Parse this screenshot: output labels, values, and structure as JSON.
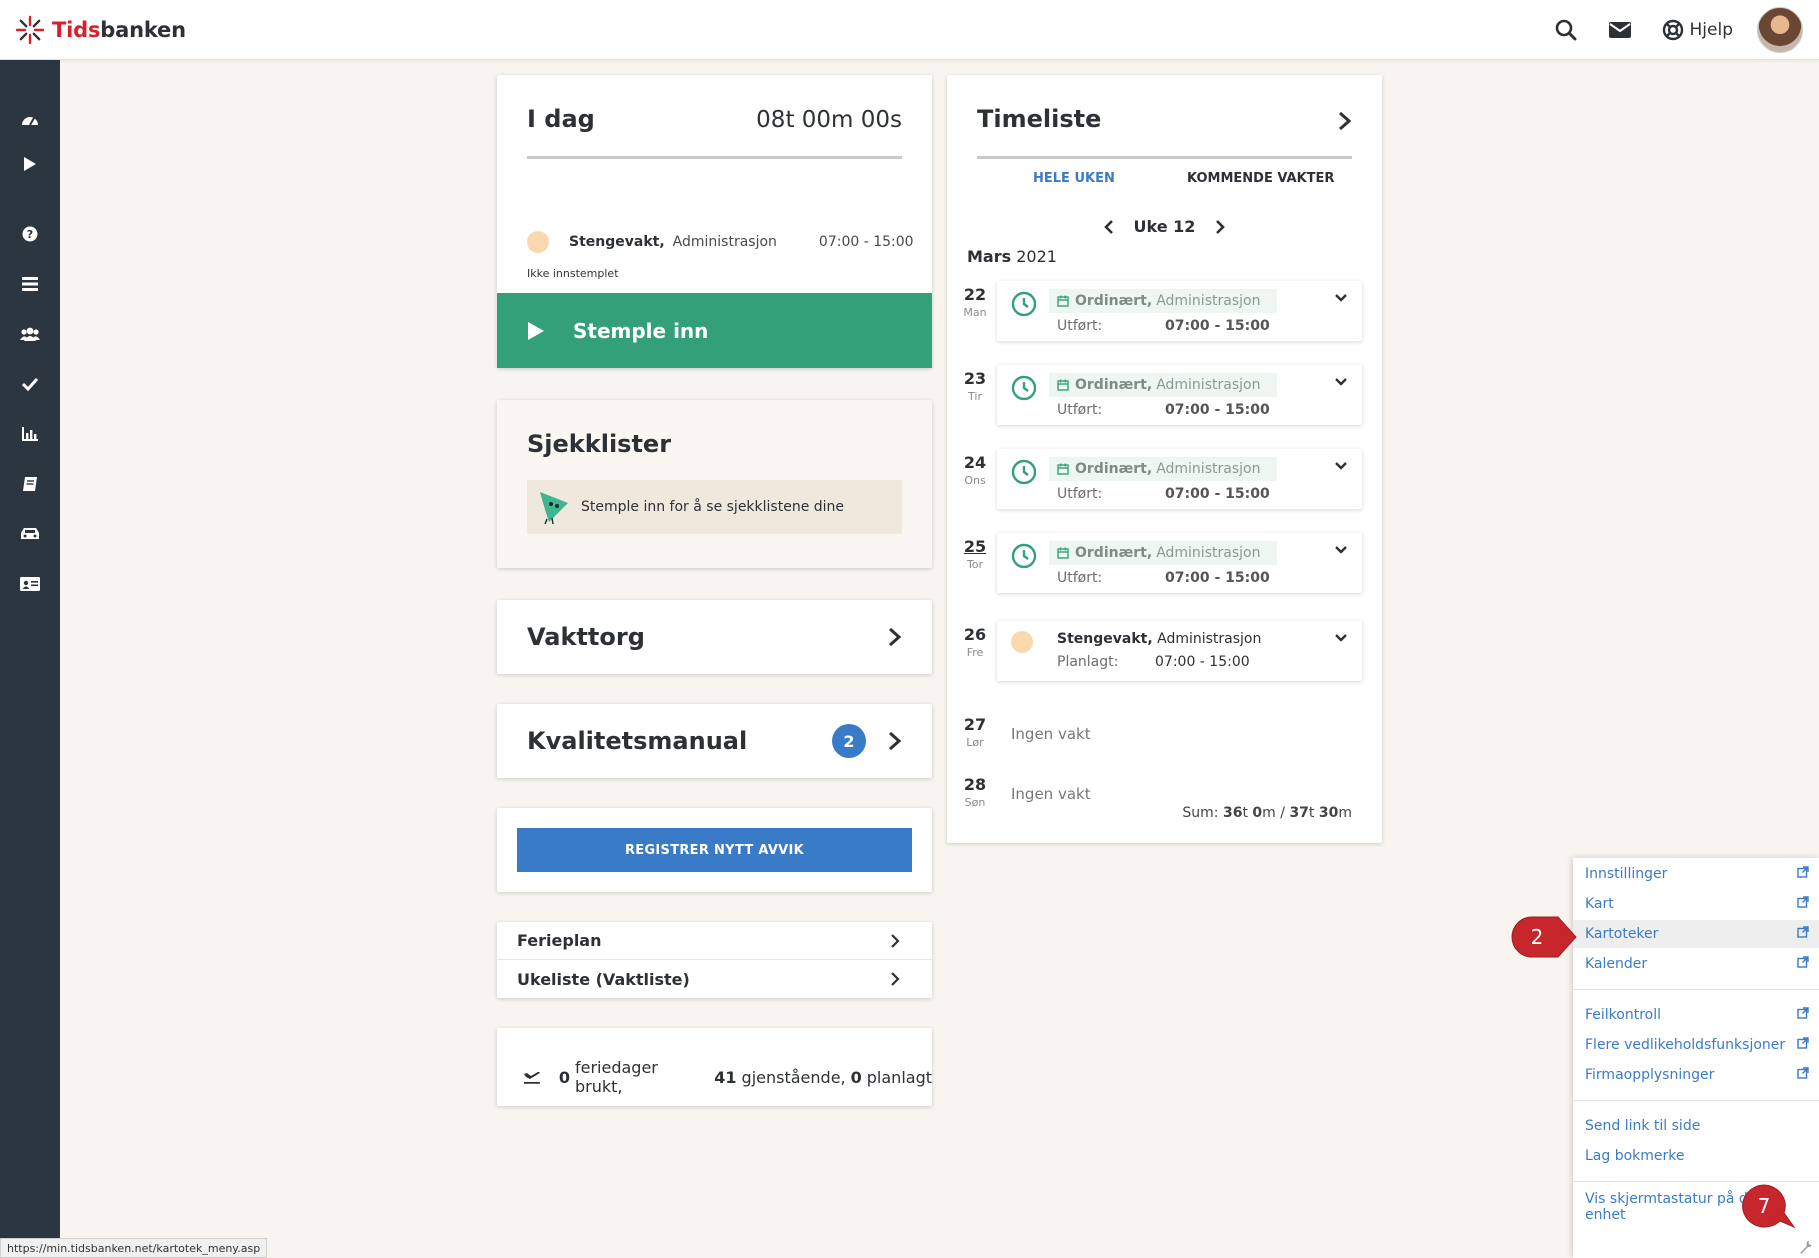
{
  "app": {
    "logo_prefix": "Tids",
    "logo_suffix": "banken",
    "help_label": "Hjelp"
  },
  "today": {
    "title": "I dag",
    "time": "08t 00m 00s",
    "shift_name": "Stengevakt,",
    "shift_dept": "Administrasjon",
    "shift_time": "07:00 - 15:00",
    "status": "Ikke innstemplet",
    "stamp_label": "Stemple inn"
  },
  "checklists": {
    "title": "Sjekklister",
    "notice": "Stemple inn for å se sjekklistene dine"
  },
  "vakttorg": {
    "title": "Vakttorg"
  },
  "quality": {
    "title": "Kvalitetsmanual",
    "badge": "2"
  },
  "deviation": {
    "button_label": "REGISTRER NYTT AVVIK"
  },
  "links": [
    {
      "label": "Ferieplan"
    },
    {
      "label": "Ukeliste (Vaktliste)"
    }
  ],
  "vacation": {
    "used": "0",
    "used_label": "feriedager brukt,",
    "remaining": "41",
    "remaining_label": "gjenstående,",
    "planned": "0",
    "planned_label": "planlagt"
  },
  "timesheet": {
    "title": "Timeliste",
    "tab_week": "HELE UKEN",
    "tab_upcoming": "KOMMENDE VAKTER",
    "week_label": "Uke 12",
    "month": "Mars",
    "year": "2021",
    "days": [
      {
        "num": "22",
        "name": "Man",
        "kind": "done",
        "type": "Ordinært,",
        "dept": "Administrasjon",
        "sub_label": "Utført:",
        "time": "07:00 - 15:00"
      },
      {
        "num": "23",
        "name": "Tir",
        "kind": "done",
        "type": "Ordinært,",
        "dept": "Administrasjon",
        "sub_label": "Utført:",
        "time": "07:00 - 15:00"
      },
      {
        "num": "24",
        "name": "Ons",
        "kind": "done",
        "type": "Ordinært,",
        "dept": "Administrasjon",
        "sub_label": "Utført:",
        "time": "07:00 - 15:00"
      },
      {
        "num": "25",
        "name": "Tor",
        "kind": "done",
        "type": "Ordinært,",
        "dept": "Administrasjon",
        "sub_label": "Utført:",
        "time": "07:00 - 15:00"
      },
      {
        "num": "26",
        "name": "Fre",
        "kind": "planned",
        "type": "Stengevakt,",
        "dept": "Administrasjon",
        "sub_label": "Planlagt:",
        "time": "07:00 - 15:00"
      },
      {
        "num": "27",
        "name": "Lør",
        "kind": "empty",
        "empty_label": "Ingen vakt"
      },
      {
        "num": "28",
        "name": "Søn",
        "kind": "empty",
        "empty_label": "Ingen vakt"
      }
    ],
    "sum_prefix": "Sum:",
    "sum_h1": "36",
    "sum_m1": "0",
    "sum_h2": "37",
    "sum_m2": "30",
    "unit_t": "t",
    "unit_m": "m",
    "sum_sep": " / "
  },
  "context_menu": {
    "group1": [
      "Innstillinger",
      "Kart",
      "Kartoteker",
      "Kalender"
    ],
    "group2": [
      "Feilkontroll",
      "Flere vedlikeholdsfunksjoner",
      "Firmaopplysninger"
    ],
    "group3": [
      "Send link til side",
      "Lag bokmerke"
    ],
    "group4": [
      "Vis skjermtastatur på denne enhet"
    ]
  },
  "markers": {
    "first": "2",
    "second": "7"
  },
  "status_url": "https://min.tidsbanken.net/kartotek_meny.asp",
  "colors": {
    "green": "#34a07a",
    "blue": "#3a7bc8",
    "sidebar": "#2b3641",
    "marker_red": "#c8262d"
  }
}
